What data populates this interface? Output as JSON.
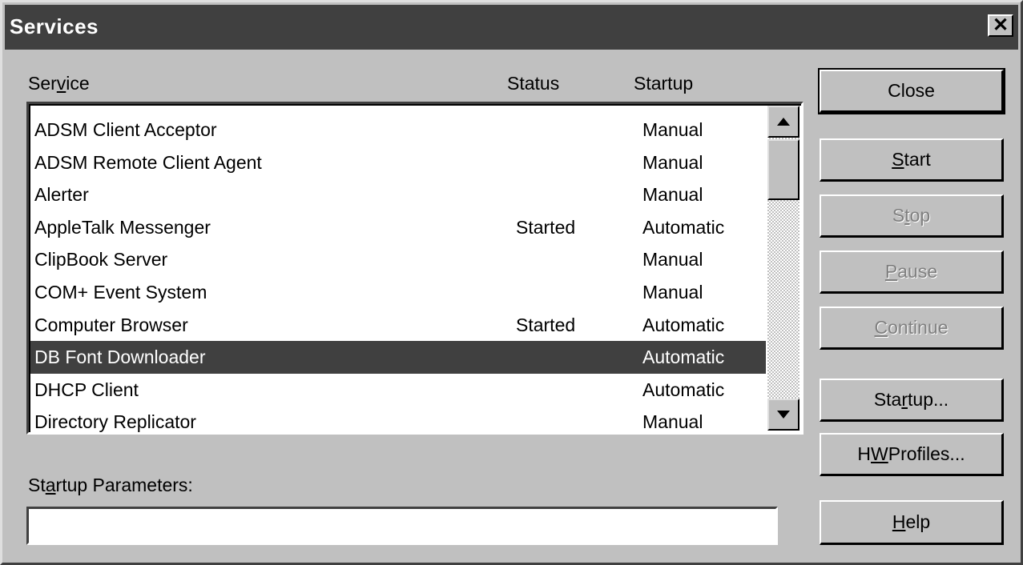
{
  "window": {
    "title": "Services",
    "close_glyph": "✕"
  },
  "columns": {
    "service": {
      "before": "Ser",
      "mnemonic": "v",
      "after": "ice"
    },
    "status": "Status",
    "startup": "Startup"
  },
  "services": [
    {
      "name": "ADSM Client Acceptor",
      "status": "",
      "startup": "Manual",
      "selected": false
    },
    {
      "name": "ADSM Remote Client Agent",
      "status": "",
      "startup": "Manual",
      "selected": false
    },
    {
      "name": "Alerter",
      "status": "",
      "startup": "Manual",
      "selected": false
    },
    {
      "name": "AppleTalk Messenger",
      "status": "Started",
      "startup": "Automatic",
      "selected": false
    },
    {
      "name": "ClipBook Server",
      "status": "",
      "startup": "Manual",
      "selected": false
    },
    {
      "name": "COM+ Event System",
      "status": "",
      "startup": "Manual",
      "selected": false
    },
    {
      "name": "Computer Browser",
      "status": "Started",
      "startup": "Automatic",
      "selected": false
    },
    {
      "name": "DB Font Downloader",
      "status": "",
      "startup": "Automatic",
      "selected": true
    },
    {
      "name": "DHCP Client",
      "status": "",
      "startup": "Automatic",
      "selected": false
    },
    {
      "name": "Directory Replicator",
      "status": "",
      "startup": "Manual",
      "selected": false
    }
  ],
  "buttons": {
    "close": {
      "label": "Close"
    },
    "start": {
      "mnemonic": "S",
      "after": "tart",
      "enabled": true
    },
    "stop": {
      "before": "S",
      "mnemonic": "t",
      "after": "op",
      "enabled": false
    },
    "pause": {
      "mnemonic": "P",
      "after": "ause",
      "enabled": false
    },
    "continue": {
      "mnemonic": "C",
      "after": "ontinue",
      "enabled": false
    },
    "startup": {
      "before": "Sta",
      "mnemonic": "r",
      "after": "tup...",
      "enabled": true
    },
    "hw_profiles": {
      "before": "H",
      "mnemonic": "W",
      "after": " Profiles...",
      "enabled": true
    },
    "help": {
      "mnemonic": "H",
      "after": "elp",
      "enabled": true
    }
  },
  "startup_parameters": {
    "label": {
      "before": "St",
      "mnemonic": "a",
      "after": "rtup Parameters:"
    },
    "value": ""
  },
  "scrollbar": {
    "up_icon": "arrow-up-icon",
    "down_icon": "arrow-down-icon"
  },
  "colors": {
    "face": "#c0c0c0",
    "titlebar": "#404040",
    "selection": "#404040",
    "disabled_text": "#808080"
  }
}
